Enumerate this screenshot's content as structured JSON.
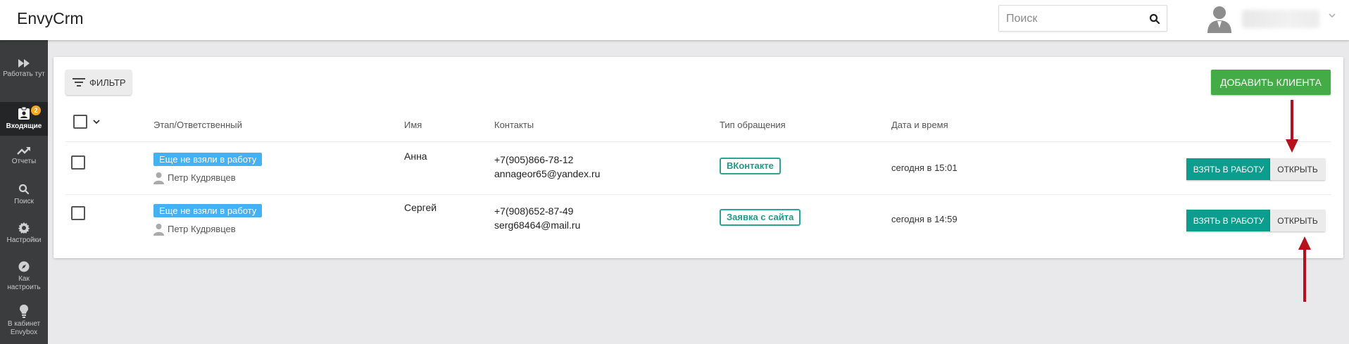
{
  "header": {
    "logo": "EnvyCrm",
    "search": {
      "placeholder": "Поиск",
      "value": ""
    },
    "user": {
      "icon": "user-avatar-icon"
    }
  },
  "sidebar": {
    "items": [
      {
        "label": "Работать тут",
        "icon": "fast-forward-icon"
      },
      {
        "label": "Входящие",
        "icon": "inbox-person-icon",
        "badge": "2",
        "active": true
      },
      {
        "label": "Отчеты",
        "icon": "trending-up-icon"
      },
      {
        "label": "Поиск",
        "icon": "search-icon"
      },
      {
        "label": "Настройки",
        "icon": "gear-icon"
      },
      {
        "label": "Как настроить",
        "icon": "compass-icon"
      },
      {
        "label": "В кабинет Envybox",
        "icon": "lightbulb-icon"
      }
    ]
  },
  "toolbar": {
    "filter_label": "ФИЛЬТР",
    "add_client_label": "ДОБАВИТЬ КЛИЕНТА"
  },
  "table": {
    "columns": [
      "Этап/Ответственный",
      "Имя",
      "Контакты",
      "Тип обращения",
      "Дата и время"
    ],
    "rows": [
      {
        "stage": "Еще не взяли в работу",
        "responsible": "Петр Кудрявцев",
        "name": "Анна",
        "phone": "+7(905)866-78-12",
        "email": "annageor65@yandex.ru",
        "type": "ВКонтакте",
        "datetime": "сегодня в 15:01",
        "take_label": "ВЗЯТЬ В РАБОТУ",
        "open_label": "ОТКРЫТЬ"
      },
      {
        "stage": "Еще не взяли в работу",
        "responsible": "Петр Кудрявцев",
        "name": "Сергей",
        "phone": "+7(908)652-87-49",
        "email": "serg68464@mail.ru",
        "type": "Заявка с сайта",
        "datetime": "сегодня в 14:59",
        "take_label": "ВЗЯТЬ В РАБОТУ",
        "open_label": "ОТКРЫТЬ"
      }
    ]
  },
  "colors": {
    "sidebar_bg": "#3a3c3e",
    "accent_green": "#43ac47",
    "teal": "#0b9d8e",
    "stage_blue": "#45b0f2",
    "badge_orange": "#f5a623",
    "annotation_red": "#b5121b"
  }
}
